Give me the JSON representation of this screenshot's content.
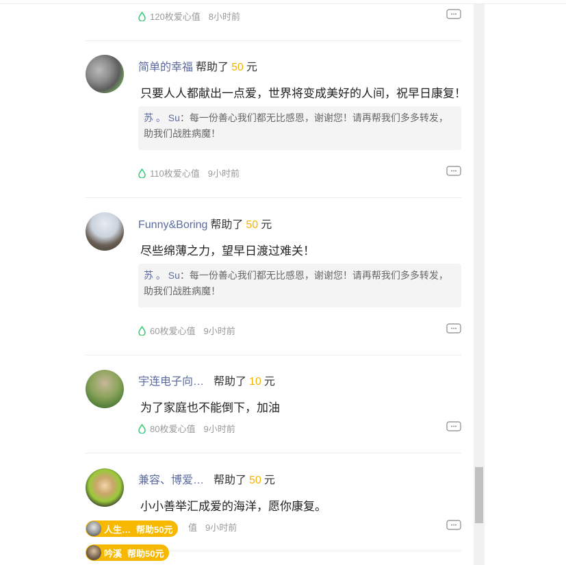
{
  "comments": [
    {
      "meta": {
        "points": "120枚爱心值",
        "time": "8小时前"
      }
    },
    {
      "name": "简单的幸福",
      "help_prefix": "帮助了",
      "amount": "50",
      "unit": "元",
      "message": "只要人人都献出一点爱，世界将变成美好的人间，祝早日康复！",
      "reply_name": "苏 。 Su",
      "reply_text": "：每一份善心我们都无比感恩，谢谢您！请再帮我们多多转发，助我们战胜病魔！",
      "meta": {
        "points": "110枚爱心值",
        "time": "9小时前"
      }
    },
    {
      "name": "Funny&Boring",
      "help_prefix": "帮助了",
      "amount": "50",
      "unit": "元",
      "message": "尽些绵薄之力，望早日渡过难关！",
      "reply_name": "苏 。 Su",
      "reply_text": "：每一份善心我们都无比感恩，谢谢您！请再帮我们多多转发，助我们战胜病魔！",
      "meta": {
        "points": "60枚爱心值",
        "time": "9小时前"
      }
    },
    {
      "name": "宇连电子向…",
      "help_prefix": "帮助了",
      "amount": "10",
      "unit": "元",
      "message": "为了家庭也不能倒下，加油",
      "meta": {
        "points": "80枚爱心值",
        "time": "9小时前"
      }
    },
    {
      "name": "兼容、博爱…",
      "help_prefix": "帮助了",
      "amount": "50",
      "unit": "元",
      "message": "小小善举汇成爱的海洋，愿你康复。",
      "meta": {
        "points": "值",
        "time": "9小时前"
      }
    }
  ],
  "badges": [
    {
      "name": "人生…",
      "text": "帮助50元"
    },
    {
      "name": "吟溪",
      "text": "帮助50元"
    }
  ],
  "icons": {
    "drop": "water-drop-icon",
    "comment": "comment-bubble-icon"
  },
  "colors": {
    "accent": "#f6b400",
    "username": "#5a6aa0",
    "drop": "#2ecc71"
  }
}
